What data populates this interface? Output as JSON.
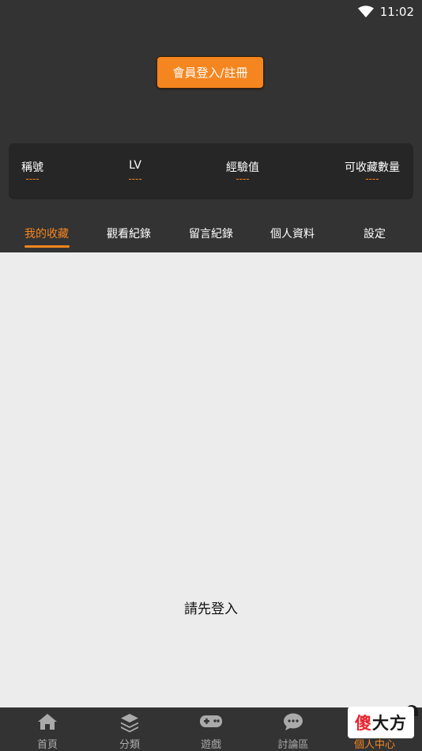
{
  "status_bar": {
    "time": "11:02"
  },
  "header": {
    "login_button_label": "會員登入/註冊"
  },
  "stats": [
    {
      "label": "稱號",
      "value": "----"
    },
    {
      "label": "LV",
      "value": "----"
    },
    {
      "label": "經驗值",
      "value": "----"
    },
    {
      "label": "可收藏數量",
      "value": "----"
    }
  ],
  "tabs": [
    {
      "label": "我的收藏",
      "active": true
    },
    {
      "label": "觀看紀錄",
      "active": false
    },
    {
      "label": "留言紀錄",
      "active": false
    },
    {
      "label": "個人資料",
      "active": false
    },
    {
      "label": "設定",
      "active": false
    }
  ],
  "content": {
    "empty_message": "請先登入"
  },
  "bottom_nav": [
    {
      "label": "首頁",
      "icon": "home-icon"
    },
    {
      "label": "分類",
      "icon": "layers-icon"
    },
    {
      "label": "遊戲",
      "icon": "gamepad-icon"
    },
    {
      "label": "討論區",
      "icon": "chat-icon"
    },
    {
      "label": "個人中心",
      "icon": "person-icon",
      "active": true
    }
  ],
  "watermark": {
    "part1": "傻",
    "part2": "大方"
  },
  "colors": {
    "accent": "#f5861f",
    "dark": "#333333",
    "card": "#262626",
    "background": "#ececec"
  }
}
